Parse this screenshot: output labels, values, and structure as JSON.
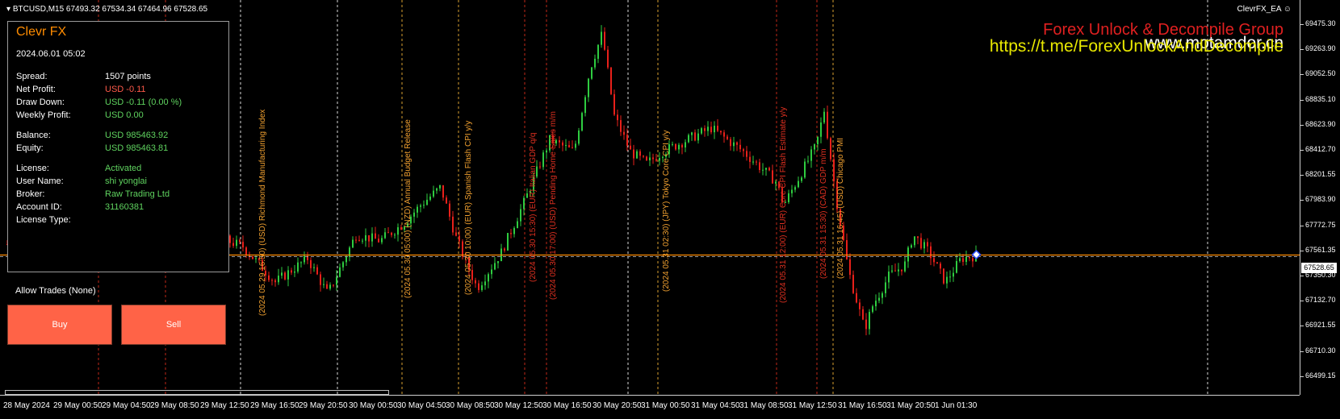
{
  "symbol_line": "BTCUSD,M15  67493.32 67534.34 67464.96 67528.65",
  "ea_name": "ClevrFX_EA ☺",
  "watermark": {
    "line1": "Forex Unlock & Decompile Group",
    "line2": "www.motamdor.cn",
    "line3": "https://t.me/ForexUnlockAndDecompile"
  },
  "panel": {
    "title": "Clevr FX",
    "datetime": "2024.06.01 05:02",
    "rows": [
      {
        "k": "Spread:",
        "v": "1507 points",
        "color": "#ffffff"
      },
      {
        "k": "Net Profit:",
        "v": "USD -0.11",
        "color": "#ff5a4a"
      },
      {
        "k": "Draw Down:",
        "v": "USD -0.11 (0.00 %)",
        "color": "#5fd35f"
      },
      {
        "k": "Weekly Profit:",
        "v": "USD 0.00",
        "color": "#5fd35f"
      },
      {
        "k": "Balance:",
        "v": "USD 985463.92",
        "color": "#5fd35f"
      },
      {
        "k": "Equity:",
        "v": "USD 985463.81",
        "color": "#5fd35f"
      },
      {
        "k": "License:",
        "v": "Activated",
        "color": "#5fd35f"
      },
      {
        "k": "User Name:",
        "v": "shi yonglai",
        "color": "#5fd35f"
      },
      {
        "k": "Broker:",
        "v": "Raw Trading Ltd",
        "color": "#5fd35f"
      },
      {
        "k": "Account ID:",
        "v": "31160381",
        "color": "#5fd35f"
      },
      {
        "k": "License Type:",
        "v": "",
        "color": "#5fd35f"
      }
    ],
    "allow_trades": "Allow Trades (None)",
    "buy_label": "Buy",
    "sell_label": "Sell"
  },
  "price_axis": {
    "ticks": [
      "69475.30",
      "69263.90",
      "69052.50",
      "68835.10",
      "68623.90",
      "68412.70",
      "68201.55",
      "67983.90",
      "67772.75",
      "67561.35",
      "67350.30",
      "67132.70",
      "66921.55",
      "66710.30",
      "66499.15"
    ],
    "current_price": "67528.65",
    "range": [
      66499.15,
      69475.3
    ],
    "current_price_value": 67528.65
  },
  "time_axis": {
    "ticks": [
      "28 May 2024",
      "29 May 00:50",
      "29 May 04:50",
      "29 May 08:50",
      "29 May 12:50",
      "29 May 16:50",
      "29 May 20:50",
      "30 May 00:50",
      "30 May 04:50",
      "30 May 08:50",
      "30 May 12:50",
      "30 May 16:50",
      "30 May 20:50",
      "31 May 00:50",
      "31 May 04:50",
      "31 May 08:50",
      "31 May 12:50",
      "31 May 16:50",
      "31 May 20:50",
      "1 Jun 01:30"
    ]
  },
  "news_events": [
    {
      "text": "(2024 05.29 16:50) (USD) Richmond Manufacturing Index",
      "color": "#f0a030"
    },
    {
      "text": "(2024 05.30 05:00) (NZD) Annual Budget Release",
      "color": "#f0a030"
    },
    {
      "text": "(2024 05.30 10:00) (EUR) Spanish Flash CPI y/y",
      "color": "#f0a030"
    },
    {
      "text": "(2024 05.30 15:30) (EUR) Italian GDP q/q",
      "color": "#e03020"
    },
    {
      "text": "(2024 05.30 17:00) (USD) Pending Home Sales m/m",
      "color": "#e03020"
    },
    {
      "text": "(2024 05.31 02:30) (JPY) Tokyo Core CPI y/y",
      "color": "#f0a030"
    },
    {
      "text": "(2024 05.31 12:00) (EUR) Core CPI Flash Estimate y/y",
      "color": "#e03020"
    },
    {
      "text": "(2024 05.31 15:30) (CAD) GDP m/m",
      "color": "#e03020"
    },
    {
      "text": "(2024 05.31 16:45) (USD) Chicago PMI",
      "color": "#f0a030"
    }
  ],
  "colors": {
    "bull": "#2ecc40",
    "bear": "#e8201a",
    "grid_orange": "#d9a030",
    "grid_red": "#c02818",
    "grid_white": "#d8d8d8",
    "price_line": "#ff8c00",
    "button": "#ff6347"
  }
}
